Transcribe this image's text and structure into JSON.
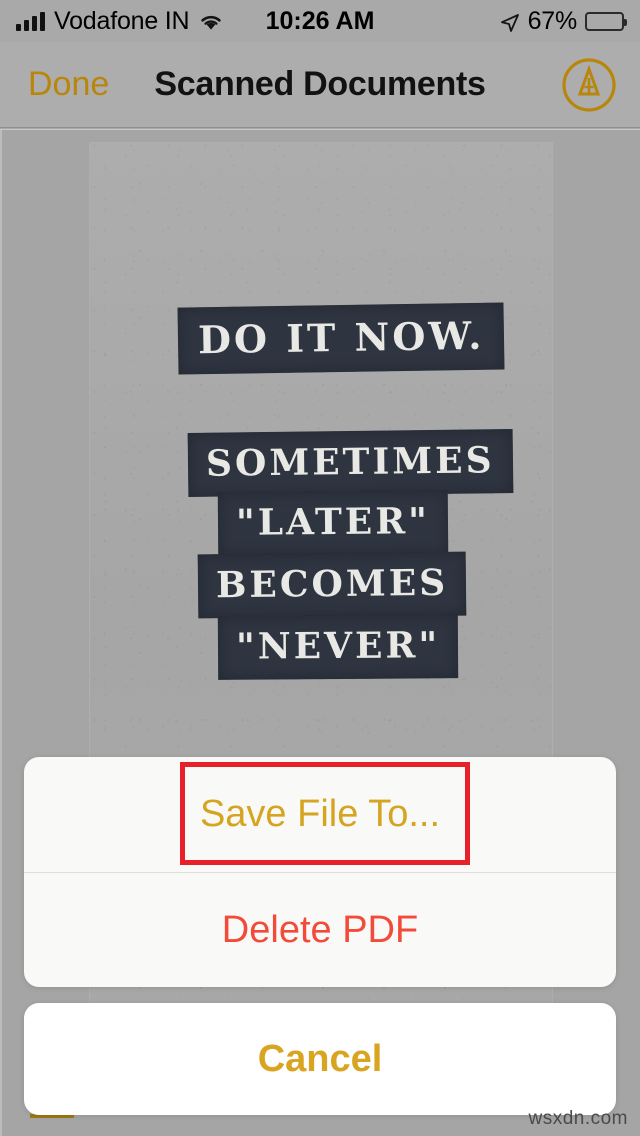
{
  "status_bar": {
    "signal_icon": "signal-bars-icon",
    "carrier": "Vodafone IN",
    "wifi_icon": "wifi-icon",
    "time": "10:26 AM",
    "location_icon": "location-arrow-icon",
    "battery_percent": "67%",
    "battery_icon": "battery-icon",
    "battery_level": 67
  },
  "nav_bar": {
    "done_label": "Done",
    "title": "Scanned Documents",
    "markup_icon": "markup-pen-icon"
  },
  "scan_preview": {
    "document_lines": [
      "DO IT NOW.",
      "SOMETIMES",
      "\"LATER\"",
      "BECOMES",
      "\"NEVER\""
    ]
  },
  "action_sheet": {
    "save_label": "Save File To...",
    "delete_label": "Delete PDF",
    "cancel_label": "Cancel"
  },
  "annotation": {
    "highlight_color": "#e8202a",
    "highlight_target": "Save File To..."
  },
  "colors": {
    "tint_gold": "#d5a420",
    "destructive_red": "#f24b3a",
    "annotation_red": "#e8202a",
    "sheet_background": "#f9f9f8",
    "dimmed_backdrop": "#a5a5a5"
  },
  "watermark": "wsxdn.com"
}
